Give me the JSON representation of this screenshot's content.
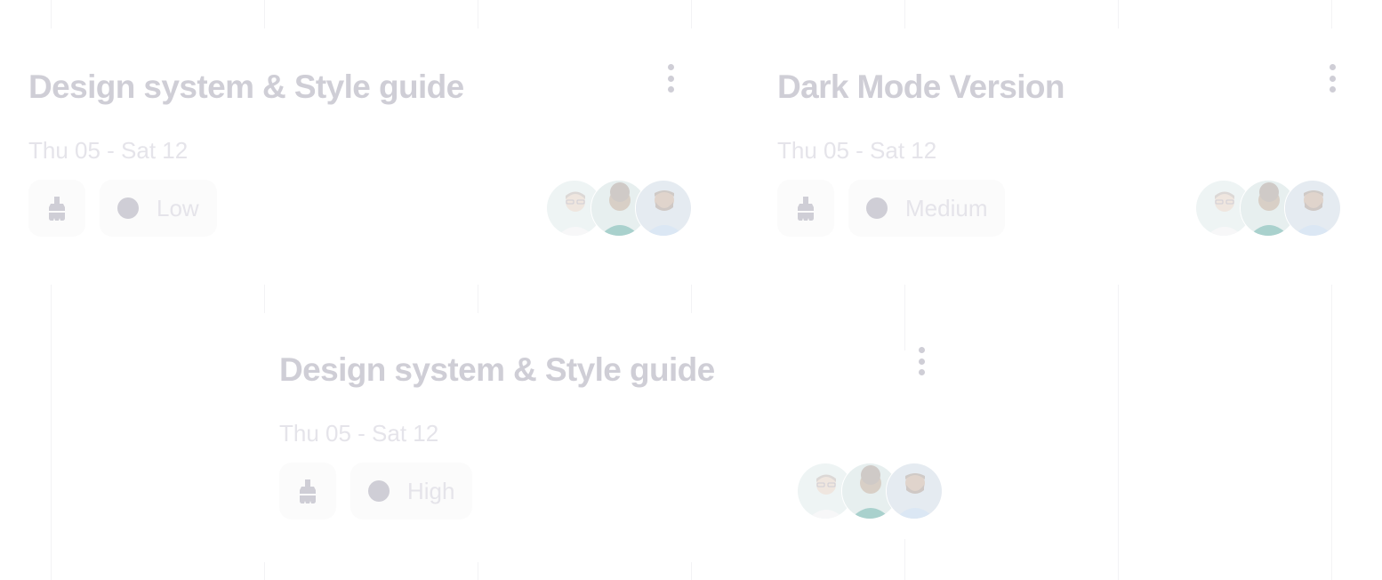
{
  "cards": [
    {
      "title": "Design system & Style guide",
      "date": "Thu 05 - Sat 12",
      "priority": "Low",
      "menu_icon": "kebab-menu-icon",
      "tag_icon": "brush-icon",
      "priority_icon": "circle-dot-icon",
      "avatars": [
        "avatar-man-glasses",
        "avatar-man-curly-hair",
        "avatar-man-beard"
      ]
    },
    {
      "title": "Dark Mode Version",
      "date": "Thu 05 - Sat 12",
      "priority": "Medium",
      "menu_icon": "kebab-menu-icon",
      "tag_icon": "brush-icon",
      "priority_icon": "circle-dot-icon",
      "avatars": [
        "avatar-man-glasses",
        "avatar-man-curly-hair",
        "avatar-man-beard"
      ]
    },
    {
      "title": "Design system & Style guide",
      "date": "Thu 05 - Sat 12",
      "priority": "High",
      "menu_icon": "kebab-menu-icon",
      "tag_icon": "brush-icon",
      "priority_icon": "circle-dot-icon",
      "avatars": [
        "avatar-man-glasses",
        "avatar-man-curly-hair",
        "avatar-man-beard"
      ]
    }
  ],
  "colors": {
    "title": "#cfced6",
    "date": "#e5e4ea",
    "chip_bg": "#fbfbfb",
    "dot": "#cfced6",
    "gridline": "#f3f3f5"
  }
}
